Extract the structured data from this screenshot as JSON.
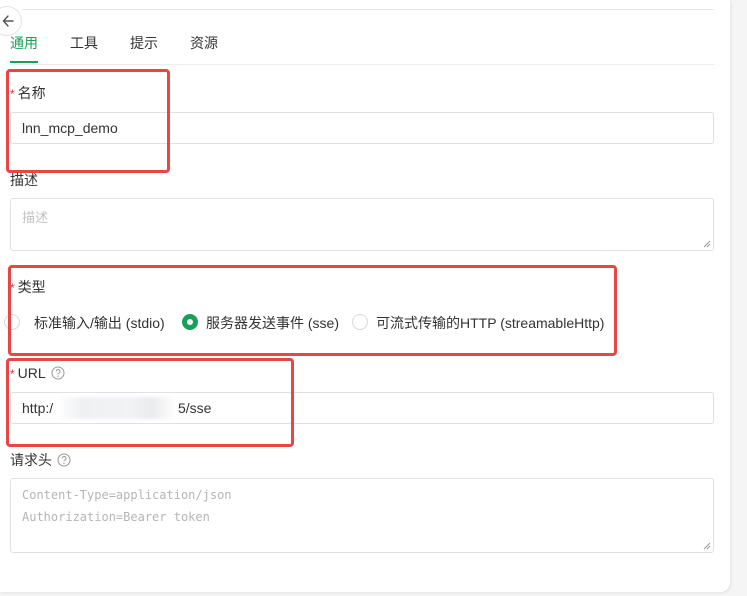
{
  "tabs": [
    {
      "label": "通用",
      "active": true
    },
    {
      "label": "工具",
      "active": false
    },
    {
      "label": "提示",
      "active": false
    },
    {
      "label": "资源",
      "active": false
    }
  ],
  "form": {
    "required_mark": "*",
    "name": {
      "label": "名称",
      "value": "lnn_mcp_demo"
    },
    "description": {
      "label": "描述",
      "placeholder": "描述"
    },
    "type": {
      "label": "类型",
      "options": [
        {
          "label": "标准输入/输出 (stdio)",
          "checked": false
        },
        {
          "label": "服务器发送事件 (sse)",
          "checked": true
        },
        {
          "label": "可流式传输的HTTP (streamableHttp)",
          "checked": false
        }
      ]
    },
    "url": {
      "label": "URL",
      "value_prefix": "http:/",
      "value_suffix": "5/sse"
    },
    "headers": {
      "label": "请求头",
      "placeholder_lines": [
        "Content-Type=application/json",
        "Authorization=Bearer token"
      ]
    }
  },
  "icons": {
    "back": "arrow-left-icon",
    "help": "question-circle-icon"
  },
  "colors": {
    "accent": "#18a058",
    "required": "#d03050",
    "annotation": "#e84545"
  }
}
